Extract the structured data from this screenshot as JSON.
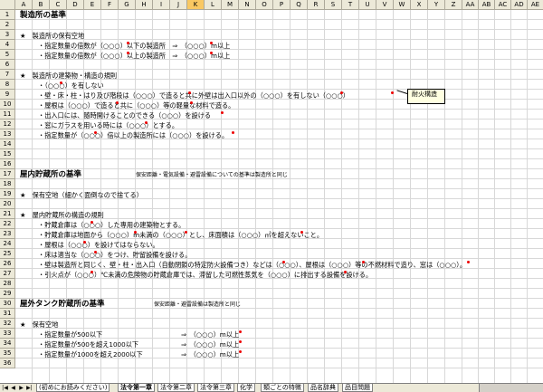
{
  "columns": [
    "A",
    "B",
    "C",
    "D",
    "E",
    "F",
    "G",
    "H",
    "I",
    "J",
    "K",
    "L",
    "M",
    "N",
    "O",
    "P",
    "Q",
    "R",
    "S",
    "T",
    "U",
    "V",
    "W",
    "X",
    "Y",
    "Z",
    "AA",
    "AB",
    "AC",
    "AD",
    "AE"
  ],
  "selected_column": "K",
  "rows": [
    "1",
    "2",
    "3",
    "4",
    "5",
    "6",
    "7",
    "8",
    "9",
    "10",
    "11",
    "12",
    "13",
    "14",
    "15",
    "16",
    "17",
    "18",
    "19",
    "20",
    "21",
    "22",
    "23",
    "24",
    "25",
    "26",
    "27",
    "28",
    "29",
    "30",
    "31",
    "32",
    "33",
    "34",
    "35",
    "36"
  ],
  "cells": {
    "r1": "製造所の基準",
    "r3": "★　製造所の保有空地",
    "r4": "・指定数量の倍数が（○○○）以下の製造所　⇒　（○○○）m以上",
    "r5": "・指定数量の倍数が（○○○）以上の製造所　⇒　（○○○）m以上",
    "r7": "★　製造所の建築物・構造の規則",
    "r8": "・（○○○）を有しない",
    "r9": "・壁・床・柱・はり及び階段は（○○○）で造ると共に外壁は出入口以外の（○○○）を有しない（○○○）",
    "r10": "・屋根は（○○○）で造ると共に（○○○）等の軽量な材料で造る。",
    "r11": "・出入口には、随時開けることのできる（○○○）を設ける",
    "r12": "・窓にガラスを用いる時には（○○○）とする。",
    "r13": "・指定数量が（○○○）倍以上の製造所には（○○○）を設ける。",
    "r17": "屋内貯蔵所の基準",
    "r17_note": "保安距離・電気設備・避雷設備についての基準は製造所と同じ",
    "r19": "★　保有空地（細かく面倒なので捨てる）",
    "r21": "★　屋内貯蔵所の構造の規則",
    "r22": "・貯蔵倉庫は（○○○）した専用の建築物とする。",
    "r23": "・貯蔵倉庫は地面から（○○○）m未満の（○○○）とし、床面積は（○○○）㎡を超えないこと。",
    "r24": "・屋根は（○○○）を設けてはならない。",
    "r25": "・床は適当な（○○○）をつけ、貯留設備を設ける。",
    "r26": "・壁は製造所と同じく、壁・柱・出入口（自動閉鎖の特定防火設備つき）などは（○○○）、屋根は（○○○）等の不燃材料で造り、窓は（○○○）。",
    "r27": "・引火点が（○○○）℃未満の危険物の貯蔵倉庫では、滞留した可燃性蒸気を（○○○）に排出する設備を設ける。",
    "r30": "屋外タンク貯蔵所の基準",
    "r30_note": "保安距離・避雷設備は製造所と同じ",
    "r33": "★　保有空地",
    "r34a": "・指定数量が500以下",
    "r34b": "⇒　（○○○）m以上",
    "r35a": "・指定数量が500を超え1000以下",
    "r35b": "⇒　（○○○）m以上",
    "r36a": "・指定数量が1000を超え2000以下",
    "r36b": "⇒　（○○○）m以上"
  },
  "comment": "耐火構造",
  "sheet_tabs": [
    "(初めにお読みください)",
    "法令第一章",
    "法令第二章",
    "法令第三章",
    "化学",
    "類ごとの特徴",
    "品名辞典",
    "品目問題"
  ],
  "active_tab_index": 1,
  "nav_buttons": [
    "|◀",
    "◀",
    "▶",
    "▶|"
  ]
}
